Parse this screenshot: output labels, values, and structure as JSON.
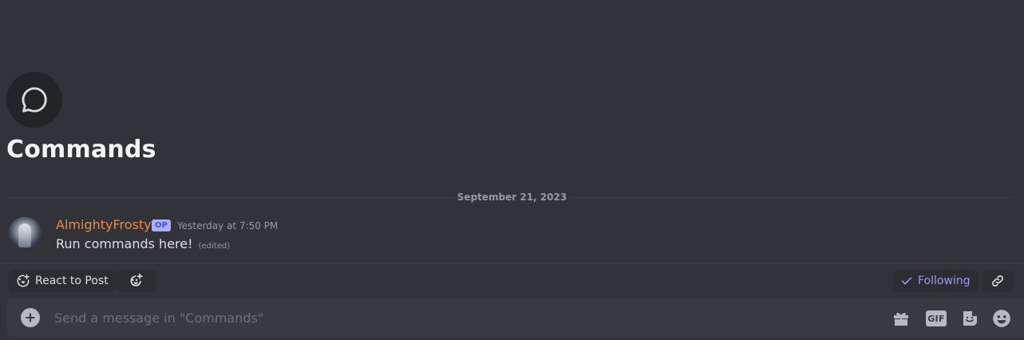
{
  "thread": {
    "title": "Commands",
    "icon": "chat-bubble-icon"
  },
  "date_divider": "September 21, 2023",
  "message": {
    "author": "AlmightyFrosty",
    "badge": "OP",
    "timestamp": "Yesterday at 7:50 PM",
    "text": "Run commands here!",
    "edited_label": "(edited)"
  },
  "actions": {
    "react_label": "React to Post",
    "following_label": "Following"
  },
  "composer": {
    "placeholder": "Send a message in \"Commands\"",
    "value": "",
    "gif_label": "GIF"
  },
  "colors": {
    "background": "#313338",
    "username": "#f0883e",
    "following": "#949cf7",
    "op_badge": "#a8b1ff"
  }
}
